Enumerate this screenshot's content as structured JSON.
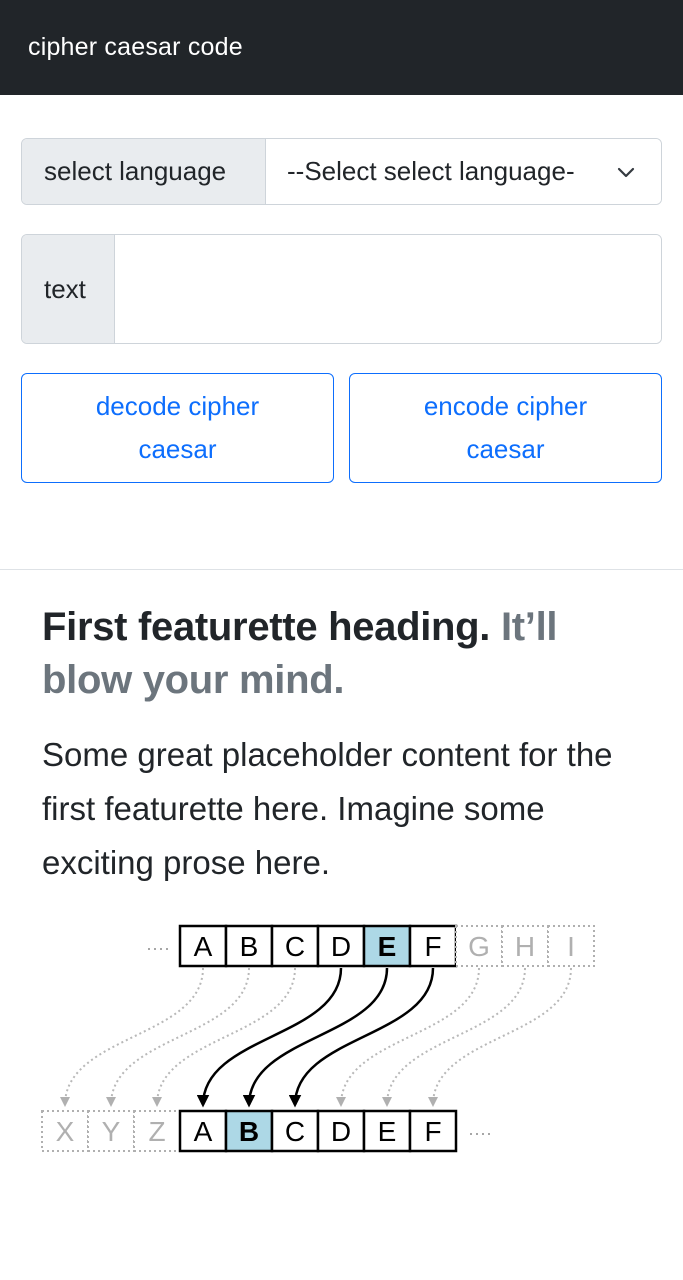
{
  "navbar": {
    "brand": "cipher caesar code"
  },
  "form": {
    "language_label": "select language",
    "language_select_value": "--Select select language-",
    "text_label": "text",
    "text_value": ""
  },
  "buttons": {
    "decode_line1": "decode cipher",
    "decode_line2": "caesar",
    "encode_line1": "encode cipher",
    "encode_line2": "caesar"
  },
  "featurette": {
    "heading": "First featurette heading.",
    "heading_muted": "It’ll blow your mind.",
    "lead": "Some great placeholder content for the first featurette here. Imagine some exciting prose here."
  },
  "diagram": {
    "top_ellipsis": "····",
    "top_letters": [
      "A",
      "B",
      "C",
      "D",
      "E",
      "F"
    ],
    "top_faded": [
      "G",
      "H",
      "I"
    ],
    "bottom_faded": [
      "X",
      "Y",
      "Z"
    ],
    "bottom_letters": [
      "A",
      "B",
      "C",
      "D",
      "E",
      "F"
    ],
    "bottom_ellipsis": "····",
    "highlight_top": "E",
    "highlight_bottom": "B",
    "highlight_color": "#add8e6"
  },
  "colors": {
    "navbar_bg": "#212529",
    "accent": "#0d6efd",
    "muted": "#6c757d"
  }
}
